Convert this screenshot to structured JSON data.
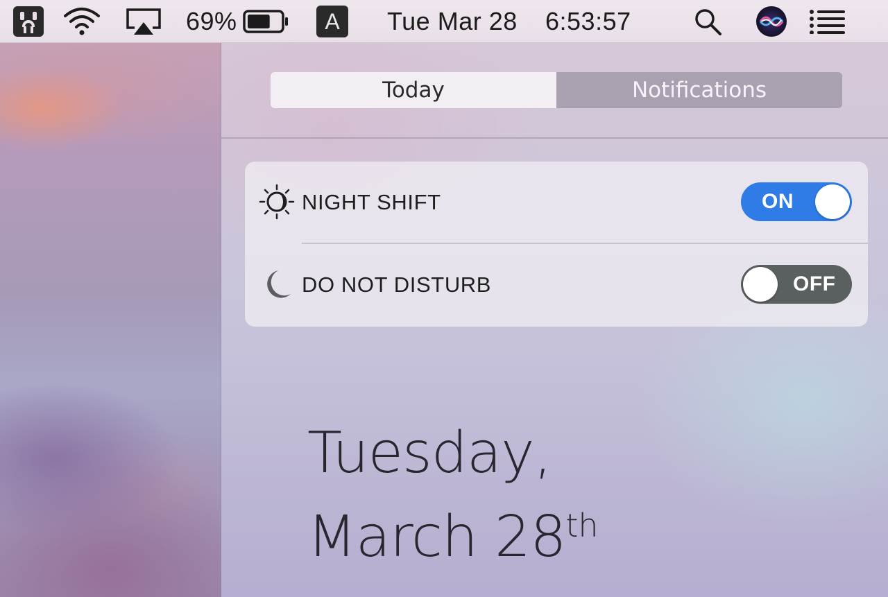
{
  "menubar": {
    "battery_percent_text": "69%",
    "battery_level": 0.69,
    "input_source_label": "A",
    "date_text": "Tue Mar 28",
    "time_text": "6:53:57",
    "icons": [
      "outlet-app-icon",
      "wifi-icon",
      "airplay-icon",
      "battery-icon",
      "input-source-icon",
      "spotlight-search-icon",
      "siri-icon",
      "notification-center-icon"
    ]
  },
  "notification_center": {
    "tabs": [
      {
        "label": "Today",
        "active": true
      },
      {
        "label": "Notifications",
        "active": false
      }
    ],
    "toggles": [
      {
        "label": "NIGHT SHIFT",
        "state_text": "ON",
        "on": true,
        "icon": "night-shift-icon"
      },
      {
        "label": "DO NOT DISTURB",
        "state_text": "OFF",
        "on": false,
        "icon": "moon-icon"
      }
    ],
    "date": {
      "weekday": "Tuesday,",
      "month_day": "March 28",
      "ordinal_suffix": "th"
    }
  },
  "colors": {
    "toggle_on": "#2f7ce6",
    "toggle_off": "#5a5f60"
  }
}
